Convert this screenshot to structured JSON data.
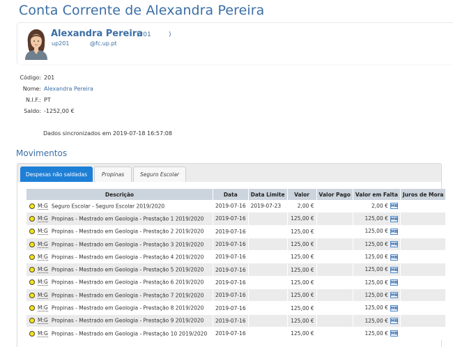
{
  "page": {
    "title": "Conta Corrente de Alexandra Pereira"
  },
  "profile": {
    "name": "Alexandra Pereira",
    "code_open": "(201",
    "code_close": ")",
    "user": "up201",
    "email": "@fc.up.pt"
  },
  "info": {
    "codigo_label": "Código:",
    "codigo": "201",
    "nome_label": "Nome:",
    "nome": "Alexandra Pereira",
    "nif_label": "N.I.F.:",
    "nif": "PT",
    "saldo_label": "Saldo:",
    "saldo": "-1252,00 €"
  },
  "sync": "Dados sincronizados em 2019-07-18 16:57:08",
  "section": {
    "title": "Movimentos"
  },
  "tabs": [
    {
      "label": "Despesas não saldadas",
      "active": true
    },
    {
      "label": "Propinas",
      "active": false
    },
    {
      "label": "Seguro Escolar",
      "active": false
    }
  ],
  "table": {
    "headers": [
      "Descrição",
      "Data",
      "Data Limite",
      "Valor",
      "Valor Pago",
      "Valor em Falta",
      "Juros de Mora"
    ],
    "rows": [
      {
        "tag": "M:G",
        "desc": "Seguro Escolar - Seguro Escolar 2019/2020",
        "data": "2019-07-16",
        "limite": "2019-07-23",
        "valor": "2,00 €",
        "pago": "",
        "falta": "2,00 €",
        "pay": "MB",
        "juros": ""
      },
      {
        "tag": "M:G",
        "desc": "Propinas - Mestrado em Geologia - Prestação 1 2019/2020",
        "data": "2019-07-16",
        "limite": "",
        "valor": "125,00 €",
        "pago": "",
        "falta": "125,00 €",
        "pay": "MB",
        "juros": ""
      },
      {
        "tag": "M:G",
        "desc": "Propinas - Mestrado em Geologia - Prestação 2 2019/2020",
        "data": "2019-07-16",
        "limite": "",
        "valor": "125,00 €",
        "pago": "",
        "falta": "125,00 €",
        "pay": "MB",
        "juros": ""
      },
      {
        "tag": "M:G",
        "desc": "Propinas - Mestrado em Geologia - Prestação 3 2019/2020",
        "data": "2019-07-16",
        "limite": "",
        "valor": "125,00 €",
        "pago": "",
        "falta": "125,00 €",
        "pay": "MB",
        "juros": ""
      },
      {
        "tag": "M:G",
        "desc": "Propinas - Mestrado em Geologia - Prestação 4 2019/2020",
        "data": "2019-07-16",
        "limite": "",
        "valor": "125,00 €",
        "pago": "",
        "falta": "125,00 €",
        "pay": "MB",
        "juros": ""
      },
      {
        "tag": "M:G",
        "desc": "Propinas - Mestrado em Geologia - Prestação 5 2019/2020",
        "data": "2019-07-16",
        "limite": "",
        "valor": "125,00 €",
        "pago": "",
        "falta": "125,00 €",
        "pay": "MB",
        "juros": ""
      },
      {
        "tag": "M:G",
        "desc": "Propinas - Mestrado em Geologia - Prestação 6 2019/2020",
        "data": "2019-07-16",
        "limite": "",
        "valor": "125,00 €",
        "pago": "",
        "falta": "125,00 €",
        "pay": "MB",
        "juros": ""
      },
      {
        "tag": "M:G",
        "desc": "Propinas - Mestrado em Geologia - Prestação 7 2019/2020",
        "data": "2019-07-16",
        "limite": "",
        "valor": "125,00 €",
        "pago": "",
        "falta": "125,00 €",
        "pay": "MB",
        "juros": ""
      },
      {
        "tag": "M:G",
        "desc": "Propinas - Mestrado em Geologia - Prestação 8 2019/2020",
        "data": "2019-07-16",
        "limite": "",
        "valor": "125,00 €",
        "pago": "",
        "falta": "125,00 €",
        "pay": "MB",
        "juros": ""
      },
      {
        "tag": "M:G",
        "desc": "Propinas - Mestrado em Geologia - Prestação 9 2019/2020",
        "data": "2019-07-16",
        "limite": "",
        "valor": "125,00 €",
        "pago": "",
        "falta": "125,00 €",
        "pay": "MB",
        "juros": ""
      },
      {
        "tag": "M:G",
        "desc": "Propinas - Mestrado em Geologia - Prestação 10 2019/2020",
        "data": "2019-07-16",
        "limite": "",
        "valor": "125,00 €",
        "pago": "",
        "falta": "125,00 €",
        "pay": "MB",
        "juros": ""
      }
    ]
  },
  "colors": {
    "accent": "#3b6ea5",
    "tab_active": "#1e7fd6",
    "header_bg": "#ccd4dd",
    "status_dot": "#f7e31a"
  }
}
